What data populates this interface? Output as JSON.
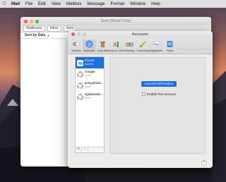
{
  "menubar": {
    "items": [
      "Mail",
      "File",
      "Edit",
      "View",
      "Mailbox",
      "Message",
      "Format",
      "Window",
      "Help"
    ]
  },
  "mail_window": {
    "title": "Sent (Read Only)",
    "toolbar": {
      "mailboxes": "Mailboxes",
      "inbox": "Inbox",
      "sent": "Sent"
    },
    "sort_label": "Sort by Date"
  },
  "prefs_window": {
    "title": "Accounts",
    "tabs": [
      {
        "label": "General",
        "icon": "switch-icon"
      },
      {
        "label": "Accounts",
        "icon": "at-sign-icon"
      },
      {
        "label": "Junk Mail",
        "icon": "trash-icon"
      },
      {
        "label": "Fonts & Colors",
        "icon": "fonts-icon"
      },
      {
        "label": "Viewing",
        "icon": "glasses-icon"
      },
      {
        "label": "Composing",
        "icon": "pencil-icon"
      },
      {
        "label": "Signatures",
        "icon": "signature-icon"
      },
      {
        "label": "Rules",
        "icon": "rules-icon"
      }
    ],
    "accounts": [
      {
        "name": "iCloud",
        "type": "Inactive",
        "selected": true
      },
      {
        "name": "Google",
        "type": "IMAP"
      },
      {
        "name": "jenny@wils...",
        "type": "IMAP"
      },
      {
        "name": "sgill@wiles...",
        "type": "IMAP"
      }
    ],
    "add_button": "+",
    "remove_button": "−",
    "segment_label": "Account Information",
    "enable_label": "Enable this account",
    "help_button": "?"
  },
  "colors": {
    "selection": "#1f6fd8",
    "close": "#fc5753",
    "minimize": "#fdbc40",
    "zoom": "#33c748"
  }
}
